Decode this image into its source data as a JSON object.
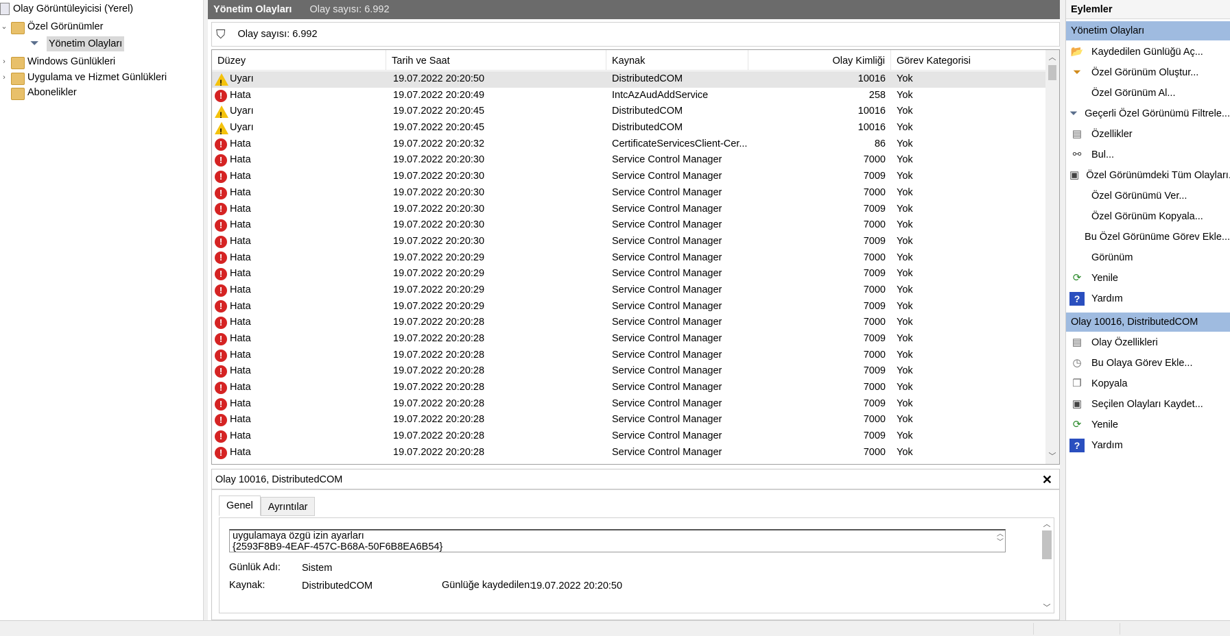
{
  "tree": {
    "root": "Olay Görüntüleyicisi (Yerel)",
    "custom_views": "Özel Görünümler",
    "admin_events": "Yönetim Olayları",
    "windows_logs": "Windows Günlükleri",
    "app_service_logs": "Uygulama ve Hizmet Günlükleri",
    "subscriptions": "Abonelikler"
  },
  "center": {
    "title": "Yönetim Olayları",
    "title_count": "Olay sayısı: 6.992",
    "filter_count": "Olay sayısı: 6.992"
  },
  "grid": {
    "columns": [
      "Düzey",
      "Tarih ve Saat",
      "Kaynak",
      "Olay Kimliği",
      "Görev Kategorisi"
    ],
    "rows": [
      {
        "level": "Uyarı",
        "type": "warn",
        "date": "19.07.2022 20:20:50",
        "source": "DistributedCOM",
        "id": "10016",
        "cat": "Yok"
      },
      {
        "level": "Hata",
        "type": "err",
        "date": "19.07.2022 20:20:49",
        "source": "IntcAzAudAddService",
        "id": "258",
        "cat": "Yok"
      },
      {
        "level": "Uyarı",
        "type": "warn",
        "date": "19.07.2022 20:20:45",
        "source": "DistributedCOM",
        "id": "10016",
        "cat": "Yok"
      },
      {
        "level": "Uyarı",
        "type": "warn",
        "date": "19.07.2022 20:20:45",
        "source": "DistributedCOM",
        "id": "10016",
        "cat": "Yok"
      },
      {
        "level": "Hata",
        "type": "err",
        "date": "19.07.2022 20:20:32",
        "source": "CertificateServicesClient-Cer...",
        "id": "86",
        "cat": "Yok"
      },
      {
        "level": "Hata",
        "type": "err",
        "date": "19.07.2022 20:20:30",
        "source": "Service Control Manager",
        "id": "7000",
        "cat": "Yok"
      },
      {
        "level": "Hata",
        "type": "err",
        "date": "19.07.2022 20:20:30",
        "source": "Service Control Manager",
        "id": "7009",
        "cat": "Yok"
      },
      {
        "level": "Hata",
        "type": "err",
        "date": "19.07.2022 20:20:30",
        "source": "Service Control Manager",
        "id": "7000",
        "cat": "Yok"
      },
      {
        "level": "Hata",
        "type": "err",
        "date": "19.07.2022 20:20:30",
        "source": "Service Control Manager",
        "id": "7009",
        "cat": "Yok"
      },
      {
        "level": "Hata",
        "type": "err",
        "date": "19.07.2022 20:20:30",
        "source": "Service Control Manager",
        "id": "7000",
        "cat": "Yok"
      },
      {
        "level": "Hata",
        "type": "err",
        "date": "19.07.2022 20:20:30",
        "source": "Service Control Manager",
        "id": "7009",
        "cat": "Yok"
      },
      {
        "level": "Hata",
        "type": "err",
        "date": "19.07.2022 20:20:29",
        "source": "Service Control Manager",
        "id": "7000",
        "cat": "Yok"
      },
      {
        "level": "Hata",
        "type": "err",
        "date": "19.07.2022 20:20:29",
        "source": "Service Control Manager",
        "id": "7009",
        "cat": "Yok"
      },
      {
        "level": "Hata",
        "type": "err",
        "date": "19.07.2022 20:20:29",
        "source": "Service Control Manager",
        "id": "7000",
        "cat": "Yok"
      },
      {
        "level": "Hata",
        "type": "err",
        "date": "19.07.2022 20:20:29",
        "source": "Service Control Manager",
        "id": "7009",
        "cat": "Yok"
      },
      {
        "level": "Hata",
        "type": "err",
        "date": "19.07.2022 20:20:28",
        "source": "Service Control Manager",
        "id": "7000",
        "cat": "Yok"
      },
      {
        "level": "Hata",
        "type": "err",
        "date": "19.07.2022 20:20:28",
        "source": "Service Control Manager",
        "id": "7009",
        "cat": "Yok"
      },
      {
        "level": "Hata",
        "type": "err",
        "date": "19.07.2022 20:20:28",
        "source": "Service Control Manager",
        "id": "7000",
        "cat": "Yok"
      },
      {
        "level": "Hata",
        "type": "err",
        "date": "19.07.2022 20:20:28",
        "source": "Service Control Manager",
        "id": "7009",
        "cat": "Yok"
      },
      {
        "level": "Hata",
        "type": "err",
        "date": "19.07.2022 20:20:28",
        "source": "Service Control Manager",
        "id": "7000",
        "cat": "Yok"
      },
      {
        "level": "Hata",
        "type": "err",
        "date": "19.07.2022 20:20:28",
        "source": "Service Control Manager",
        "id": "7009",
        "cat": "Yok"
      },
      {
        "level": "Hata",
        "type": "err",
        "date": "19.07.2022 20:20:28",
        "source": "Service Control Manager",
        "id": "7000",
        "cat": "Yok"
      },
      {
        "level": "Hata",
        "type": "err",
        "date": "19.07.2022 20:20:28",
        "source": "Service Control Manager",
        "id": "7009",
        "cat": "Yok"
      },
      {
        "level": "Hata",
        "type": "err",
        "date": "19.07.2022 20:20:28",
        "source": "Service Control Manager",
        "id": "7000",
        "cat": "Yok"
      }
    ]
  },
  "detail": {
    "title": "Olay 10016, DistributedCOM",
    "tab_general": "Genel",
    "tab_details": "Ayrıntılar",
    "desc_line1": "uygulamaya özgü izin ayarları",
    "desc_line2": "{2593F8B9-4EAF-457C-B68A-50F6B8EA6B54}",
    "log_name_label": "Günlük Adı:",
    "log_name_value": "Sistem",
    "source_label": "Kaynak:",
    "source_value": "DistributedCOM",
    "logged_label": "Günlüğe kaydedilen:",
    "logged_value": "19.07.2022 20:20:50"
  },
  "actions": {
    "header": "Eylemler",
    "section1": "Yönetim Olayları",
    "items1": [
      {
        "label": "Kaydedilen Günlüğü Aç...",
        "icon": "open-folder-icon"
      },
      {
        "label": "Özel Görünüm Oluştur...",
        "icon": "filter-create-icon"
      },
      {
        "label": "Özel Görünüm Al...",
        "icon": ""
      },
      {
        "label": "Geçerli Özel Görünümü Filtrele...",
        "icon": "filter-icon"
      },
      {
        "label": "Özellikler",
        "icon": "properties-icon"
      },
      {
        "label": "Bul...",
        "icon": "binoculars-icon"
      },
      {
        "label": "Özel Görünümdeki Tüm Olayları...",
        "icon": "save-icon"
      },
      {
        "label": "Özel Görünümü Ver...",
        "icon": ""
      },
      {
        "label": "Özel Görünüm Kopyala...",
        "icon": ""
      },
      {
        "label": "Bu Özel Görünüme Görev Ekle...",
        "icon": ""
      },
      {
        "label": "Görünüm",
        "icon": ""
      },
      {
        "label": "Yenile",
        "icon": "refresh-icon"
      },
      {
        "label": "Yardım",
        "icon": "help-icon"
      }
    ],
    "section2": "Olay 10016, DistributedCOM",
    "items2": [
      {
        "label": "Olay Özellikleri",
        "icon": "properties-icon"
      },
      {
        "label": "Bu Olaya Görev Ekle...",
        "icon": "task-icon"
      },
      {
        "label": "Kopyala",
        "icon": "copy-icon"
      },
      {
        "label": "Seçilen Olayları Kaydet...",
        "icon": "save-icon"
      },
      {
        "label": "Yenile",
        "icon": "refresh-icon"
      },
      {
        "label": "Yardım",
        "icon": "help-icon"
      }
    ]
  }
}
